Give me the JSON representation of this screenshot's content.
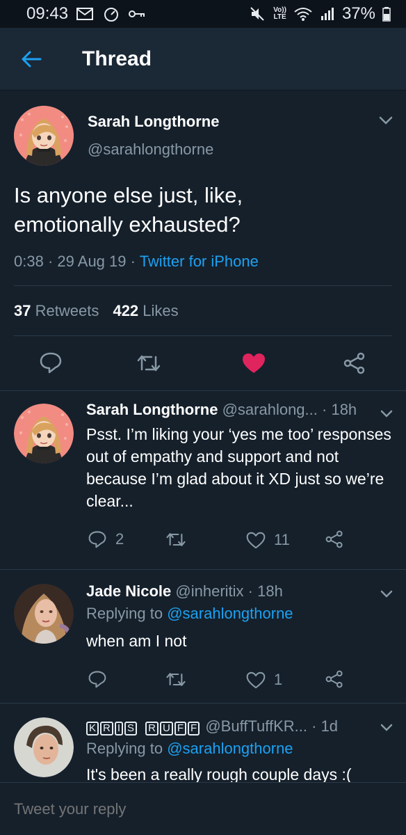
{
  "status_bar": {
    "time": "09:43",
    "battery": "37%",
    "network": "LTE"
  },
  "header": {
    "title": "Thread"
  },
  "main_tweet": {
    "author_name": "Sarah Longthorne",
    "author_handle": "@sarahlongthorne",
    "text": "Is anyone else just, like, emotionally exhausted?",
    "time": "0:38",
    "date": "29 Aug 19",
    "source": "Twitter for iPhone",
    "retweets_count": "37",
    "retweets_label": "Retweets",
    "likes_count": "422",
    "likes_label": "Likes"
  },
  "replies": [
    {
      "author_name": "Sarah Longthorne",
      "author_handle": "@sarahlong...",
      "time": "18h",
      "text": "Psst. I’m liking your ‘yes me too’ responses out of empathy and support and not because I’m glad about it XD just so we’re clear...",
      "reply_count": "2",
      "retweet_count": "",
      "like_count": "11"
    },
    {
      "author_name": "Jade Nicole",
      "author_handle": "@inheritix",
      "time": "18h",
      "replying_prefix": "Replying to",
      "replying_to": "@sarahlongthorne",
      "text": "when am I not",
      "reply_count": "",
      "retweet_count": "",
      "like_count": "1"
    },
    {
      "author_name_letters": [
        "K",
        "R",
        "I",
        "S",
        "R",
        "U",
        "F",
        "F"
      ],
      "author_handle": "@BuffTuffKR...",
      "time": "1d",
      "replying_prefix": "Replying to",
      "replying_to": "@sarahlongthorne",
      "text": "It's been a really rough couple days :("
    }
  ],
  "reply_bar": {
    "placeholder": "Tweet your reply"
  },
  "colors": {
    "background": "#15202b",
    "accent": "#1da1f2",
    "like_red": "#e0245e",
    "muted": "#8899a6"
  }
}
